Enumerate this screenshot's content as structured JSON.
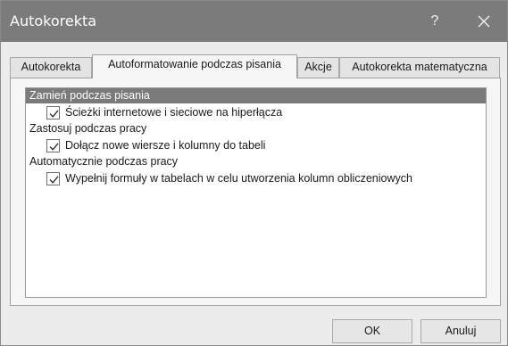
{
  "window": {
    "title": "Autokorekta",
    "help_label": "?"
  },
  "tabs": [
    {
      "label": "Autokorekta",
      "active": false
    },
    {
      "label": "Autoformatowanie podczas pisania",
      "active": true
    },
    {
      "label": "Akcje",
      "active": false
    },
    {
      "label": "Autokorekta matematyczna",
      "active": false
    }
  ],
  "groups": [
    {
      "header": "Zamień podczas pisania",
      "selected": true,
      "items": [
        {
          "label": "Ścieżki internetowe i sieciowe na hiperłącza",
          "checked": true
        }
      ]
    },
    {
      "header": "Zastosuj podczas pracy",
      "selected": false,
      "items": [
        {
          "label": "Dołącz nowe wiersze i kolumny do tabeli",
          "checked": true
        }
      ]
    },
    {
      "header": "Automatycznie podczas pracy",
      "selected": false,
      "items": [
        {
          "label": "Wypełnij formuły w tabelach w celu utworzenia kolumn obliczeniowych",
          "checked": true
        }
      ]
    }
  ],
  "buttons": {
    "ok": "OK",
    "cancel": "Anuluj"
  },
  "colors": {
    "titlebar": "#7b7b7b",
    "selected_header": "#7a7a7a",
    "dialog_bg": "#ececec"
  }
}
